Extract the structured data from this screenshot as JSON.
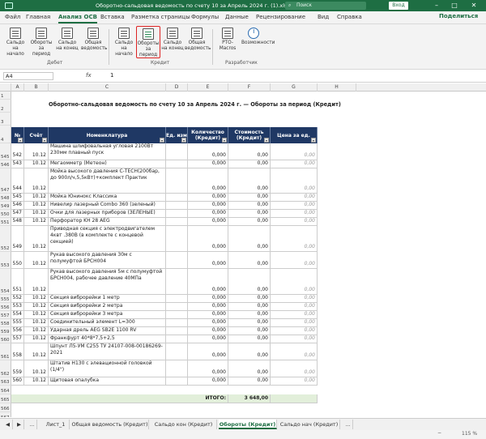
{
  "window": {
    "title": "Оборотно-сальдовая ведомость по счету 10 за Апрель 2024 г. (1).xlsx - Ex...",
    "search": "Поиск",
    "login": "Вход"
  },
  "tabs": [
    "Файл",
    "Главная",
    "Анализ ОСВ",
    "Вставка",
    "Разметка страницы",
    "Формулы",
    "Данные",
    "Рецензирование",
    "Вид",
    "Справка"
  ],
  "share": "Поделиться",
  "ribbon": {
    "debit": [
      {
        "label": "Сальдо на начало"
      },
      {
        "label": "Обороты за период"
      },
      {
        "label": "Сальдо на конец"
      },
      {
        "label": "Общая ведомость"
      }
    ],
    "credit": [
      {
        "label": "Сальдо на начало"
      },
      {
        "label": "Обороты за период"
      },
      {
        "label": "Сальдо на конец"
      },
      {
        "label": "Общая ведомость"
      }
    ],
    "dev": [
      {
        "label": "PTO-Macros"
      },
      {
        "label": "Возможности"
      }
    ],
    "groups": {
      "debit": "Дебет",
      "credit": "Кредит",
      "dev": "Разработчик"
    }
  },
  "formula": {
    "namebox": "A4",
    "fx": "fx",
    "value": "1"
  },
  "columns": [
    "A",
    "B",
    "C",
    "D",
    "E",
    "F",
    "G",
    "H"
  ],
  "report_title": "Оборотно-сальдовая ведомость по счету 10 за Апрель 2024 г. — Обороты за период (Кредит)",
  "headers": {
    "no": "№",
    "acc": "Счёт",
    "name": "Номенклатура",
    "unit": "Ед. изм",
    "qty": "Количество (Кредит)",
    "sum": "Стоимость (Кредит)",
    "price": "Цена за ед."
  },
  "rows": [
    {
      "r": "545",
      "no": "542",
      "acc": "10.12",
      "name": "Машина шлифовальная угловая 2100Вт 230мм плавный пуск",
      "qty": "0,000",
      "sum": "0,00",
      "price": "0,00"
    },
    {
      "r": "546",
      "no": "543",
      "acc": "10.12",
      "name": "Мегаомметр (Метеон)",
      "qty": "0,000",
      "sum": "0,00",
      "price": "0,00"
    },
    {
      "r": "547",
      "no": "544",
      "acc": "10.12",
      "name": "Мойка высокого давления С-ТЕСН(200бар, до 900л/ч,5,5кВт)+комплект Практик",
      "qty": "0,000",
      "sum": "0,00",
      "price": "0,00"
    },
    {
      "r": "548",
      "no": "545",
      "acc": "10.12",
      "name": "Мойка Юнинокс Классика",
      "qty": "0,000",
      "sum": "0,00",
      "price": "0,00"
    },
    {
      "r": "549",
      "no": "546",
      "acc": "10.12",
      "name": "Нивелир лазерный Combo 360 (зеленый)",
      "qty": "0,000",
      "sum": "0,00",
      "price": "0,00"
    },
    {
      "r": "550",
      "no": "547",
      "acc": "10.12",
      "name": "Очки для лазерных приборов (ЗЕЛЕНЫЕ)",
      "qty": "0,000",
      "sum": "0,00",
      "price": "0,00"
    },
    {
      "r": "551",
      "no": "548",
      "acc": "10.12",
      "name": "Перфоратор KH 28 AEG",
      "qty": "0,000",
      "sum": "0,00",
      "price": "0,00"
    },
    {
      "r": "552",
      "no": "549",
      "acc": "10.12",
      "name": "Приводная секция с электродвигателем 4квт .380В (в комплекте с концевой секцией)",
      "qty": "0,000",
      "sum": "0,00",
      "price": "0,00"
    },
    {
      "r": "553",
      "no": "550",
      "acc": "10.12",
      "name": "Рукав высокого давления 30м с полумуфтой БРСН004",
      "qty": "0,000",
      "sum": "0,00",
      "price": "0,00"
    },
    {
      "r": "554",
      "no": "551",
      "acc": "10.12",
      "name": "Рукав высокого давления 5м с полумуфтой БРСН004, рабочее давление 40МПа",
      "qty": "0,000",
      "sum": "0,00",
      "price": "0,00"
    },
    {
      "r": "555",
      "no": "552",
      "acc": "10.12",
      "name": "Секция виброрейки 1 метр",
      "qty": "0,000",
      "sum": "0,00",
      "price": "0,00"
    },
    {
      "r": "556",
      "no": "553",
      "acc": "10.12",
      "name": "Секция виброрейки 2 метра",
      "qty": "0,000",
      "sum": "0,00",
      "price": "0,00"
    },
    {
      "r": "557",
      "no": "554",
      "acc": "10.12",
      "name": "Секция виброрейки 3 метра",
      "qty": "0,000",
      "sum": "0,00",
      "price": "0,00"
    },
    {
      "r": "558",
      "no": "555",
      "acc": "10.12",
      "name": "Соединительный элемент L=300",
      "qty": "0,000",
      "sum": "0,00",
      "price": "0,00"
    },
    {
      "r": "559",
      "no": "556",
      "acc": "10.12",
      "name": "Ударная дрель AEG SB2E  1100 RV",
      "qty": "0,000",
      "sum": "0,00",
      "price": "0,00"
    },
    {
      "r": "560",
      "no": "557",
      "acc": "10.12",
      "name": "Франкфурт 40*8*7,5+2,5",
      "qty": "0,000",
      "sum": "0,00",
      "price": "0,00"
    },
    {
      "r": "561",
      "no": "558",
      "acc": "10.12",
      "name": "Шпунт Л5-УМ С255 ТУ 24107-008-00186269-2021",
      "qty": "0,000",
      "sum": "0,00",
      "price": "0,00"
    },
    {
      "r": "562",
      "no": "559",
      "acc": "10.12",
      "name": "Штатив Н130 с элевационной головкой (1/4\")",
      "qty": "0,000",
      "sum": "0,00",
      "price": "0,00"
    },
    {
      "r": "563",
      "no": "560",
      "acc": "10.12",
      "name": "Щитовая опалубка",
      "qty": "0,000",
      "sum": "0,00",
      "price": "0,00"
    }
  ],
  "total": {
    "label": "ИТОГО:",
    "sum": "3 648,00"
  },
  "extra_rows": [
    "564",
    "565",
    "566",
    "567",
    "568"
  ],
  "header_row_labels": [
    "1",
    "2",
    "3",
    "4"
  ],
  "sheets": [
    "Лист_1",
    "Общая ведомость (Кредит)",
    "Сальдо кон (Кредит)",
    "Обороты (Кредит)",
    "Сальдо нач (Кредит)"
  ],
  "active_sheet": "Обороты (Кредит)",
  "status": {
    "zoom": "115 %"
  }
}
